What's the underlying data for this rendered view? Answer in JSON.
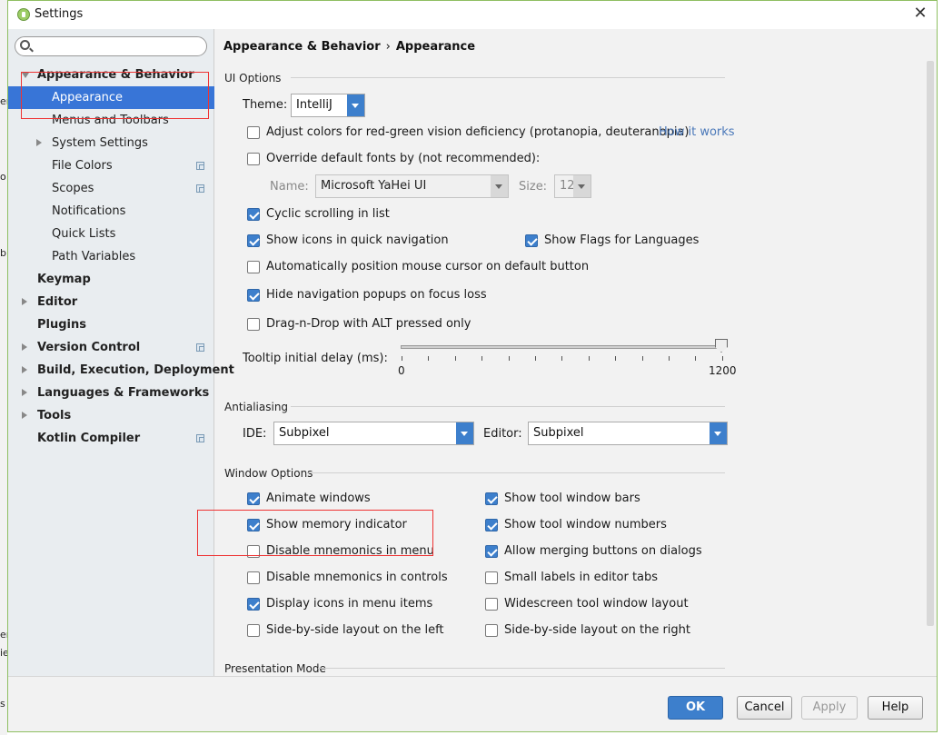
{
  "window": {
    "title": "Settings"
  },
  "background": {
    "fragments": [
      "er",
      "o",
      "b",
      "er",
      "ie",
      "s"
    ]
  },
  "search": {
    "placeholder": "",
    "value": ""
  },
  "sidebar": {
    "items": [
      {
        "label": "Appearance & Behavior",
        "bold": true,
        "expanded": true
      },
      {
        "label": "Appearance",
        "selected": true
      },
      {
        "label": "Menus and Toolbars"
      },
      {
        "label": "System Settings",
        "collapsed": true
      },
      {
        "label": "File Colors"
      },
      {
        "label": "Scopes"
      },
      {
        "label": "Notifications"
      },
      {
        "label": "Quick Lists"
      },
      {
        "label": "Path Variables"
      },
      {
        "label": "Keymap",
        "bold": true
      },
      {
        "label": "Editor",
        "bold": true,
        "collapsed": true
      },
      {
        "label": "Plugins",
        "bold": true
      },
      {
        "label": "Version Control",
        "bold": true,
        "collapsed": true
      },
      {
        "label": "Build, Execution, Deployment",
        "bold": true,
        "collapsed": true
      },
      {
        "label": "Languages & Frameworks",
        "bold": true,
        "collapsed": true
      },
      {
        "label": "Tools",
        "bold": true,
        "collapsed": true
      },
      {
        "label": "Kotlin Compiler",
        "bold": true
      }
    ]
  },
  "breadcrumb": {
    "parent": "Appearance & Behavior",
    "separator": "›",
    "current": "Appearance"
  },
  "ui_options": {
    "section_title": "UI Options",
    "theme_label": "Theme:",
    "theme_value": "IntelliJ",
    "adjust_colors": {
      "label": "Adjust colors for red-green vision deficiency (protanopia, deuteranopia)",
      "checked": false
    },
    "how_it_works": "How it works",
    "override_fonts": {
      "label": "Override default fonts by (not recommended):",
      "checked": false
    },
    "name_label": "Name:",
    "name_value": "Microsoft YaHei UI",
    "size_label": "Size:",
    "size_value": "12",
    "cyclic_scrolling": {
      "label": "Cyclic scrolling in list",
      "checked": true
    },
    "show_icons_quick_nav": {
      "label": "Show icons in quick navigation",
      "checked": true
    },
    "show_flags": {
      "label": "Show Flags for Languages",
      "checked": true
    },
    "auto_position_mouse": {
      "label": "Automatically position mouse cursor on default button",
      "checked": false
    },
    "hide_nav_popups": {
      "label": "Hide navigation popups on focus loss",
      "checked": true
    },
    "drag_n_drop_alt": {
      "label": "Drag-n-Drop with ALT pressed only",
      "checked": false
    },
    "tooltip_label": "Tooltip initial delay (ms):",
    "tooltip_min": "0",
    "tooltip_max": "1200",
    "tooltip_value": 1200
  },
  "antialiasing": {
    "section_title": "Antialiasing",
    "ide_label": "IDE:",
    "ide_value": "Subpixel",
    "editor_label": "Editor:",
    "editor_value": "Subpixel"
  },
  "window_options": {
    "section_title": "Window Options",
    "animate_windows": {
      "label": "Animate windows",
      "checked": true
    },
    "show_tool_window_bars": {
      "label": "Show tool window bars",
      "checked": true
    },
    "show_memory_indicator": {
      "label": "Show memory indicator",
      "checked": true
    },
    "show_tool_window_numbers": {
      "label": "Show tool window numbers",
      "checked": true
    },
    "disable_mnemonics_menu": {
      "label": "Disable mnemonics in menu",
      "checked": false
    },
    "allow_merging_buttons": {
      "label": "Allow merging buttons on dialogs",
      "checked": true
    },
    "disable_mnemonics_controls": {
      "label": "Disable mnemonics in controls",
      "checked": false
    },
    "small_labels_tabs": {
      "label": "Small labels in editor tabs",
      "checked": false
    },
    "display_icons_menu": {
      "label": "Display icons in menu items",
      "checked": true
    },
    "widescreen_layout": {
      "label": "Widescreen tool window layout",
      "checked": false
    },
    "side_by_side_left": {
      "label": "Side-by-side layout on the left",
      "checked": false
    },
    "side_by_side_right": {
      "label": "Side-by-side layout on the right",
      "checked": false
    }
  },
  "presentation_mode": {
    "section_title": "Presentation Mode"
  },
  "buttons": {
    "ok": "OK",
    "cancel": "Cancel",
    "apply": "Apply",
    "help": "Help"
  },
  "colors": {
    "accent": "#3d7fcc",
    "selection": "#3875d7",
    "link": "#4a78b9",
    "annotation": "#ee3333"
  }
}
